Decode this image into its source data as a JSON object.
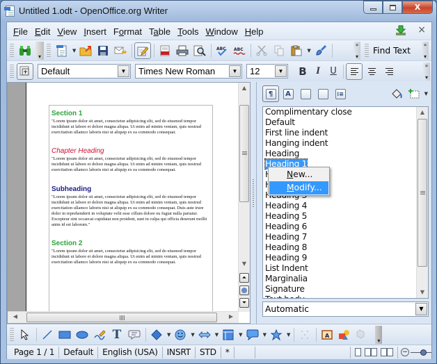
{
  "window": {
    "title": "Untitled 1.odt - OpenOffice.org Writer",
    "buttons": {
      "minimize": "—",
      "maximize": "□",
      "close": "X"
    }
  },
  "menubar": {
    "items": [
      {
        "label": "File",
        "accel": "F",
        "rest": "ile"
      },
      {
        "label": "Edit",
        "accel": "E",
        "rest": "dit"
      },
      {
        "label": "View",
        "accel": "V",
        "rest": "iew"
      },
      {
        "label": "Insert",
        "accel": "I",
        "rest": "nsert"
      },
      {
        "label": "Format",
        "pre": "F",
        "accel": "o",
        "rest": "rmat"
      },
      {
        "label": "Table",
        "pre": "T",
        "accel": "a",
        "rest": "ble"
      },
      {
        "label": "Tools",
        "accel": "T",
        "rest": "ools"
      },
      {
        "label": "Window",
        "accel": "W",
        "rest": "indow"
      },
      {
        "label": "Help",
        "accel": "H",
        "rest": "elp"
      }
    ],
    "close_doc": "×"
  },
  "standard_toolbar": {
    "find_text_label": "Find Text",
    "overflow": "»"
  },
  "formatting_toolbar": {
    "paragraph_style": "Default",
    "font_name": "Times New Roman",
    "font_size": "12",
    "bold": "B",
    "italic": "I",
    "underline": "U",
    "overflow": "»"
  },
  "document": {
    "blocks": [
      {
        "type": "section",
        "heading": "Section 1",
        "body": "\"Lorem ipsum dolor sit amet, consectetur adipisicing elit, sed do eiusmod tempor incididunt ut labore et dolore magna aliqua. Ut enim ad minim veniam, quis nostrud exercitation ullamco laboris nisi ut aliquip ex ea commodo consequat."
      },
      {
        "type": "chapter",
        "heading": "Chapter Heading",
        "body": "\"Lorem ipsum dolor sit amet, consectetur adipisicing elit, sed do eiusmod tempor incididunt ut labore et dolore magna aliqua. Ut enim ad minim veniam, quis nostrud exercitation ullamco laboris nisi ut aliquip ex ea commodo consequat."
      },
      {
        "type": "subheading",
        "heading": "Subheading",
        "body": "\"Lorem ipsum dolor sit amet, consectetur adipisicing elit, sed do eiusmod tempor incididunt ut labore et dolore magna aliqua. Ut enim ad minim veniam, quis nostrud exercitation ullamco laboris nisi ut aliquip ex ea commodo consequat. Duis aute irure dolor in reprehenderit in voluptate velit esse cillum dolore eu fugiat nulla pariatur. Excepteur sint occaecat cupidatat non proident, sunt in culpa qui officia deserunt mollit anim id est laborum.\""
      },
      {
        "type": "section",
        "heading": "Section 2",
        "body": "\"Lorem ipsum dolor sit amet, consectetur adipisicing elit, sed do eiusmod tempor incididunt ut labore et dolore magna aliqua. Ut enim ad minim veniam, quis nostrud exercitation ullamco laboris nisi ut aliquip ex ea commodo consequat."
      }
    ]
  },
  "styles_panel": {
    "styles": [
      "Complimentary close",
      "Default",
      "First line indent",
      "Hanging indent",
      "Heading",
      "Heading 1",
      "Heading 2",
      "Heading 2",
      "Heading 3",
      "Heading 4",
      "Heading 5",
      "Heading 6",
      "Heading 7",
      "Heading 8",
      "Heading 9",
      "List Indent",
      "Marginalia",
      "Signature",
      "Text body"
    ],
    "selected": "Heading 1",
    "filter": "Automatic"
  },
  "context_menu": {
    "items": [
      {
        "accel": "N",
        "rest": "ew...",
        "highlighted": false
      },
      {
        "accel": "M",
        "rest": "odify...",
        "highlighted": true
      }
    ]
  },
  "statusbar": {
    "page": "Page 1 / 1",
    "page_style": "Default",
    "language": "English (USA)",
    "insert_mode": "INSRT",
    "selection_mode": "STD",
    "modified": "*"
  }
}
